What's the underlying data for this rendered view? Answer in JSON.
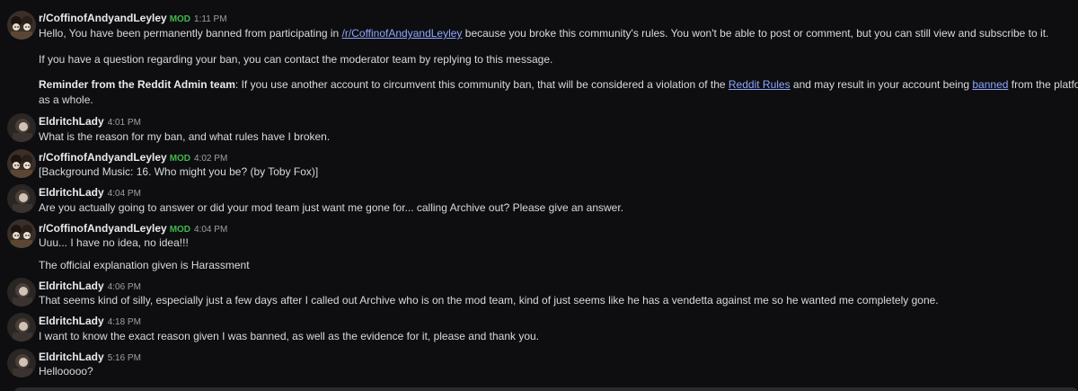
{
  "colors": {
    "background": "#0e0e10",
    "text": "#d7dadc",
    "username": "#e8eaed",
    "mod_badge": "#3fb950",
    "timestamp": "#9aa0a6",
    "link": "#8ea6ff"
  },
  "users": {
    "mod_sub": "r/CoffinofAndyandLeyley",
    "user": "EldritchLady",
    "mod_badge": "MOD"
  },
  "messages": [
    {
      "author": "r/CoffinofAndyandLeyley",
      "is_mod": true,
      "time": "1:11 PM",
      "avatar_icon": "subreddit-avatar-icon",
      "lines": {
        "l1_pre": "Hello, You have been permanently banned from participating in ",
        "l1_link": "/r/CoffinofAndyandLeyley",
        "l1_post": " because you broke this community's rules. You won't be able to post or comment, but you can still view and subscribe to it.",
        "l2": "If you have a question regarding your ban, you can contact the moderator team by replying to this message.",
        "l3_bold": "Reminder from the Reddit Admin team",
        "l3_a": ": If you use another account to circumvent this community ban, that will be considered a violation of the ",
        "l3_link1": "Reddit Rules",
        "l3_b": " and may result in your account being ",
        "l3_link2": "banned",
        "l3_c": " from the platform",
        "l4": "as a whole."
      }
    },
    {
      "author": "EldritchLady",
      "is_mod": false,
      "time": "4:01 PM",
      "avatar_icon": "user-avatar-icon",
      "text": "What is the reason for my ban, and what rules have I broken."
    },
    {
      "author": "r/CoffinofAndyandLeyley",
      "is_mod": true,
      "time": "4:02 PM",
      "avatar_icon": "subreddit-avatar-icon",
      "text": "[Background Music: 16. Who might you be? (by Toby Fox)]"
    },
    {
      "author": "EldritchLady",
      "is_mod": false,
      "time": "4:04 PM",
      "avatar_icon": "user-avatar-icon",
      "text": "Are you actually going to answer or did your mod team just want me gone for... calling Archive out? Please give an answer."
    },
    {
      "author": "r/CoffinofAndyandLeyley",
      "is_mod": true,
      "time": "4:04 PM",
      "avatar_icon": "subreddit-avatar-icon",
      "text": "Uuu... I have no idea, no idea!!!",
      "text2": "The official explanation given is Harassment"
    },
    {
      "author": "EldritchLady",
      "is_mod": false,
      "time": "4:06 PM",
      "avatar_icon": "user-avatar-icon",
      "text": "That seems kind of silly, especially just a few days after I called out Archive who is on the mod team, kind of just seems like he has a vendetta against me so he wanted me completely gone."
    },
    {
      "author": "EldritchLady",
      "is_mod": false,
      "time": "4:18 PM",
      "avatar_icon": "user-avatar-icon",
      "text": "I want to know the exact reason given I was banned, as well as the evidence for it, please and thank you."
    },
    {
      "author": "EldritchLady",
      "is_mod": false,
      "time": "5:16 PM",
      "avatar_icon": "user-avatar-icon",
      "text": "Hellooooo?"
    }
  ]
}
